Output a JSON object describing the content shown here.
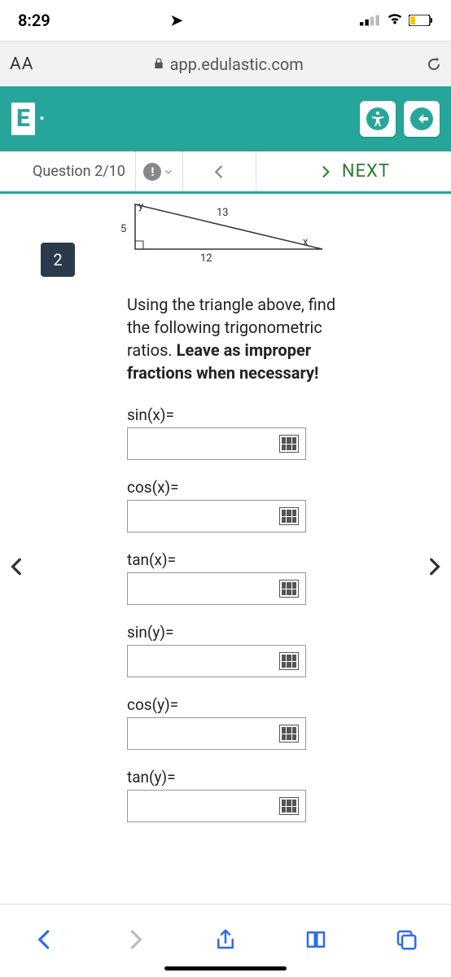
{
  "statusbar": {
    "time": "8:29"
  },
  "urlbar": {
    "aa": "AA",
    "address": "app.edulastic.com"
  },
  "appbar": {
    "brand": "E"
  },
  "qnav": {
    "label": "Question 2/10",
    "next": "NEXT"
  },
  "triangle": {
    "y_label": "y",
    "x_label": "x",
    "hyp_label": "13",
    "left_label": "5",
    "base_label": "12"
  },
  "question": {
    "number": "2",
    "prompt_pre": "Using the triangle above, find the following trigonometric ratios. ",
    "prompt_bold": "Leave as improper fractions when necessary!"
  },
  "answers": [
    {
      "label": "sin(x)="
    },
    {
      "label": "cos(x)="
    },
    {
      "label": "tan(x)="
    },
    {
      "label": "sin(y)="
    },
    {
      "label": "cos(y)="
    },
    {
      "label": "tan(y)="
    }
  ]
}
